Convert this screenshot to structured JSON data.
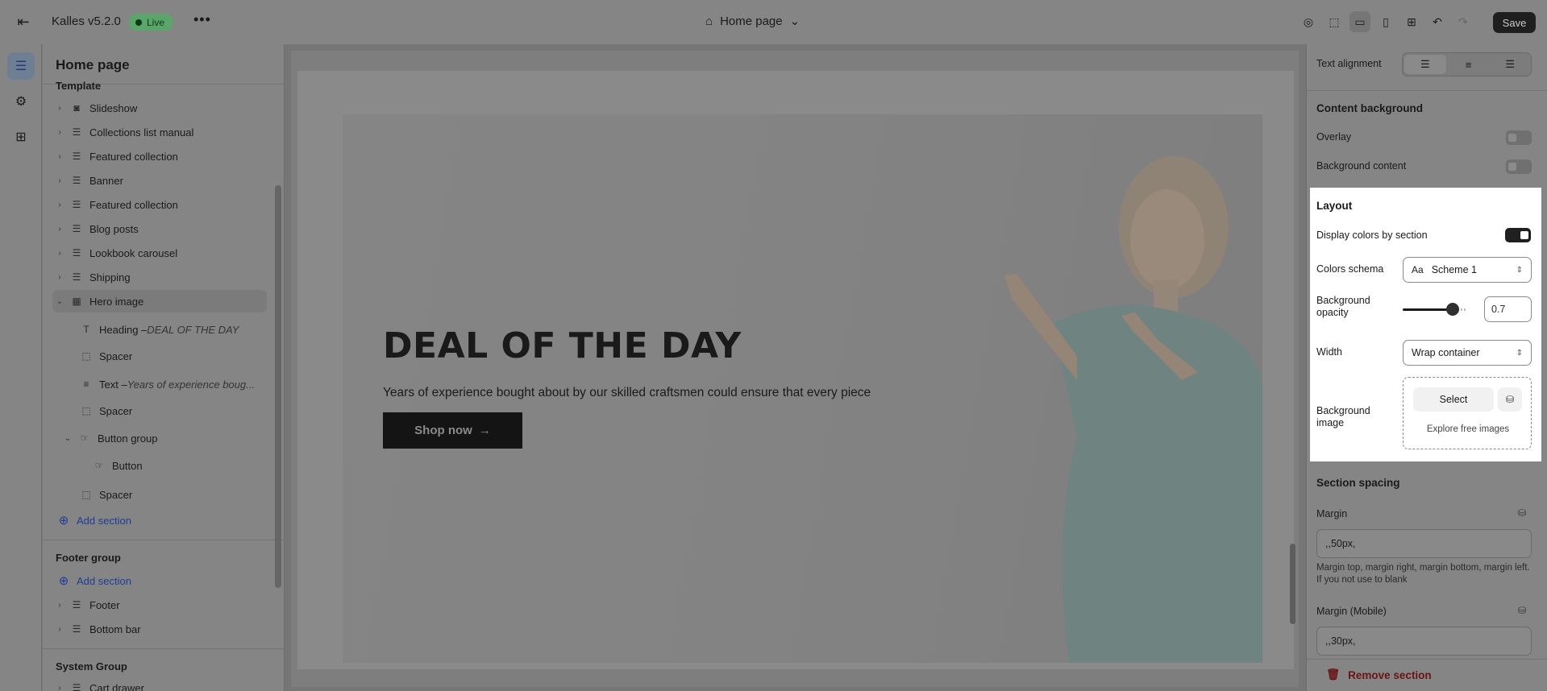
{
  "topbar": {
    "theme_name": "Kalles v5.2.0",
    "status": "Live",
    "page_selector": "Home page",
    "save_label": "Save"
  },
  "sidebar": {
    "title": "Home page",
    "template_label": "Template",
    "sections": [
      {
        "label": "Slideshow",
        "icon": "slideshow-icon"
      },
      {
        "label": "Collections list manual",
        "icon": "section-icon"
      },
      {
        "label": "Featured collection",
        "icon": "section-icon"
      },
      {
        "label": "Banner",
        "icon": "section-icon"
      },
      {
        "label": "Featured collection",
        "icon": "section-icon"
      },
      {
        "label": "Blog posts",
        "icon": "section-icon"
      },
      {
        "label": "Lookbook carousel",
        "icon": "section-icon"
      },
      {
        "label": "Shipping",
        "icon": "section-icon"
      },
      {
        "label": "Hero image",
        "icon": "section-icon",
        "selected": true
      }
    ],
    "hero_blocks": {
      "heading_prefix": "Heading – ",
      "heading_value": "DEAL OF THE DAY",
      "spacer": "Spacer",
      "text_prefix": "Text – ",
      "text_value": "Years of experience boug...",
      "button_group": "Button group",
      "button": "Button"
    },
    "add_section": "Add section",
    "footer_group_label": "Footer group",
    "footer": "Footer",
    "bottom_bar": "Bottom bar",
    "system_group_label": "System Group",
    "cart_drawer": "Cart drawer"
  },
  "preview": {
    "heading": "DEAL OF THE DAY",
    "text": "Years of experience bought about by our skilled craftsmen could ensure that every piece",
    "button": "Shop now",
    "button_arrow": "→"
  },
  "settings": {
    "text_alignment_label": "Text alignment",
    "content_background_heading": "Content background",
    "overlay_label": "Overlay",
    "background_content_label": "Background content",
    "layout_heading": "Layout",
    "display_colors_label": "Display colors by section",
    "display_colors_on": true,
    "colors_schema_label": "Colors schema",
    "colors_schema_value": "Scheme 1",
    "bg_opacity_label": "Background opacity",
    "bg_opacity_value": "0.7",
    "width_label": "Width",
    "width_value": "Wrap container",
    "bg_image_label": "Background image",
    "select_label": "Select",
    "explore_label": "Explore free images",
    "section_spacing_heading": "Section spacing",
    "margin_label": "Margin",
    "margin_value": ",,50px,",
    "margin_help": "Margin top, margin right, margin bottom, margin left. If you not use to blank",
    "margin_mobile_label": "Margin (Mobile)",
    "margin_mobile_value": ",,30px,",
    "remove_label": "Remove section"
  }
}
